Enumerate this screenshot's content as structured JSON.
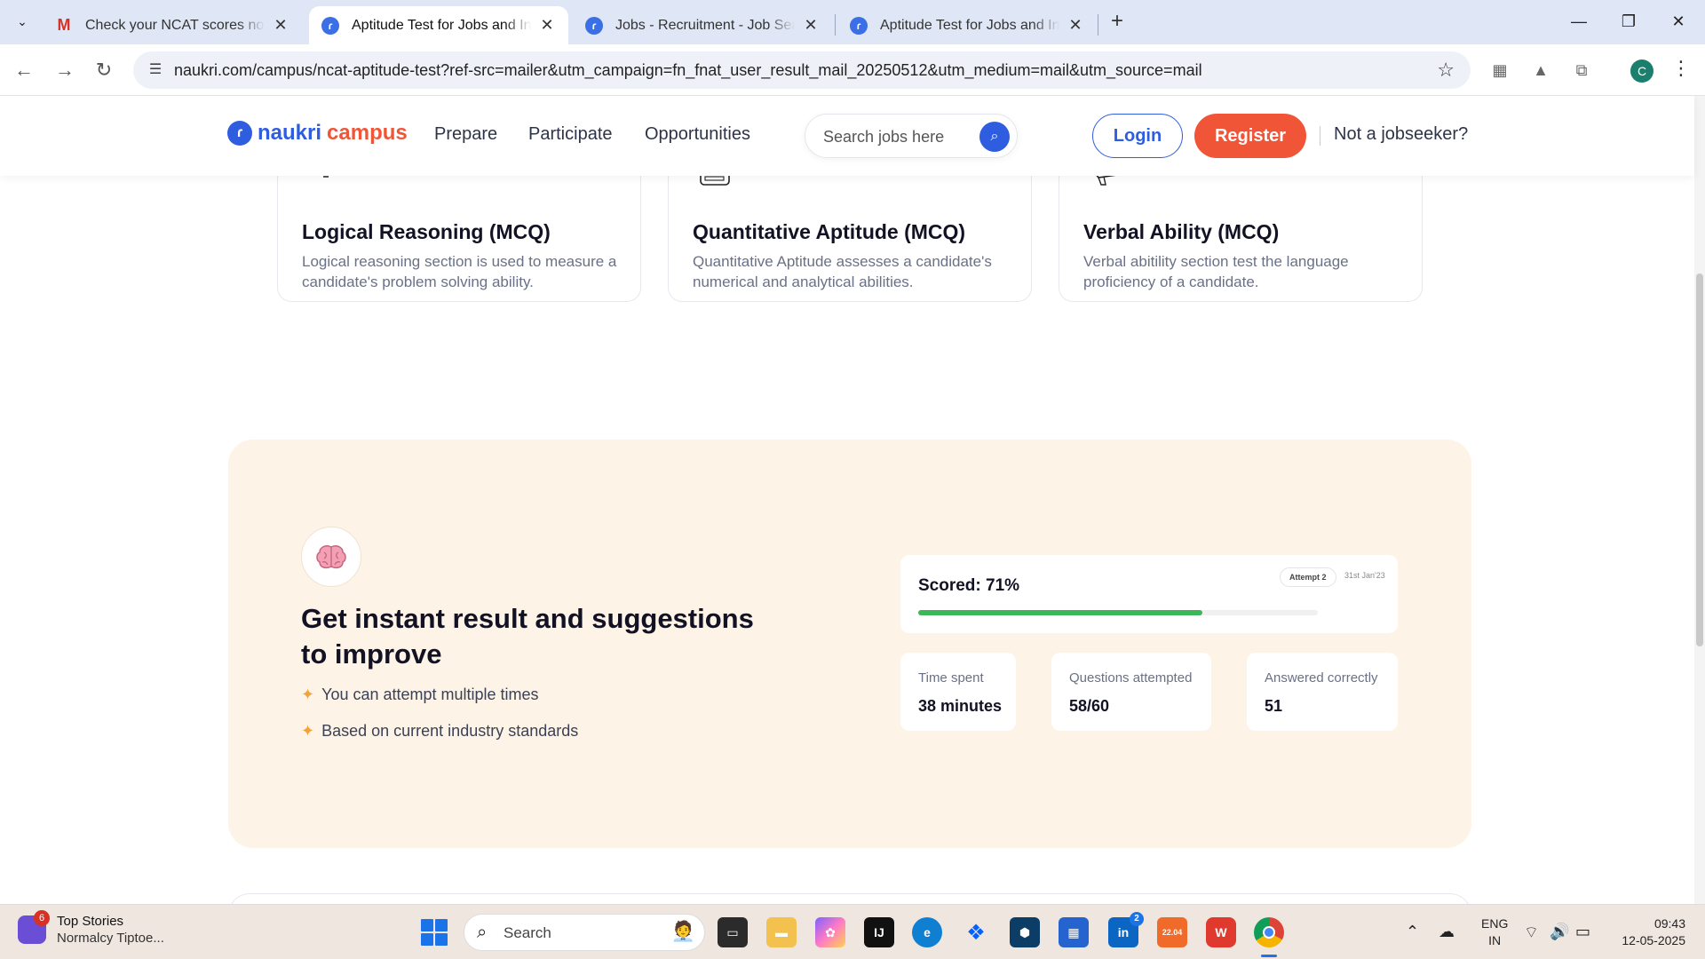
{
  "browser": {
    "tabs": [
      {
        "title": "Check your NCAT scores now - ",
        "icon": "gmail-icon",
        "active": false
      },
      {
        "title": "Aptitude Test for Jobs and Interviews",
        "icon": "naukri-icon",
        "active": true
      },
      {
        "title": "Jobs - Recruitment - Job Search",
        "icon": "naukri-icon",
        "active": false
      },
      {
        "title": "Aptitude Test for Jobs and Interviews",
        "icon": "naukri-icon",
        "active": false
      }
    ],
    "url": "naukri.com/campus/ncat-aptitude-test?ref-src=mailer&utm_campaign=fn_fnat_user_result_mail_20250512&utm_medium=mail&utm_source=mail",
    "profile_initial": "C"
  },
  "header": {
    "logo_naukri": "naukri",
    "logo_campus": "campus",
    "nav": [
      "Prepare",
      "Participate",
      "Opportunities"
    ],
    "search_placeholder": "Search jobs here",
    "login": "Login",
    "register": "Register",
    "not_jobseeker": "Not a jobseeker?"
  },
  "sections": [
    {
      "title": "Logical Reasoning (MCQ)",
      "description": "Logical reasoning section is used to measure a candidate's problem solving ability.",
      "icon": "lightbulb-icon"
    },
    {
      "title": "Quantitative Aptitude (MCQ)",
      "description": "Quantitative Aptitude assesses a candidate's numerical and analytical abilities.",
      "icon": "calculator-icon"
    },
    {
      "title": "Verbal Ability (MCQ)",
      "description": "Verbal abitility section test the language proficiency of a candidate.",
      "icon": "megaphone-icon"
    }
  ],
  "result": {
    "icon": "brain-icon",
    "heading": "Get instant result and suggestions to improve",
    "bullets": [
      "You can attempt multiple times",
      "Based on current industry standards"
    ],
    "score_label": "Scored: 71%",
    "score_percent": 71,
    "attempt": "Attempt 2",
    "date": "31st Jan'23",
    "stats": [
      {
        "label": "Time spent",
        "value": "38 minutes"
      },
      {
        "label": "Questions attempted",
        "value": "58/60"
      },
      {
        "label": "Answered correctly",
        "value": "51"
      }
    ]
  },
  "taskbar": {
    "news_badge": "6",
    "news_title": "Top Stories",
    "news_subtitle": "Normalcy Tiptoe...",
    "search_label": "Search",
    "linkedin_badge": "2",
    "calendar_date": "22.04",
    "lang_line1": "ENG",
    "lang_line2": "IN",
    "time": "09:43",
    "date": "12-05-2025"
  },
  "colors": {
    "brand_blue": "#2f5de0",
    "brand_orange": "#f05537",
    "panel_bg": "#fdf3e7",
    "progress_green": "#3eb65a"
  }
}
